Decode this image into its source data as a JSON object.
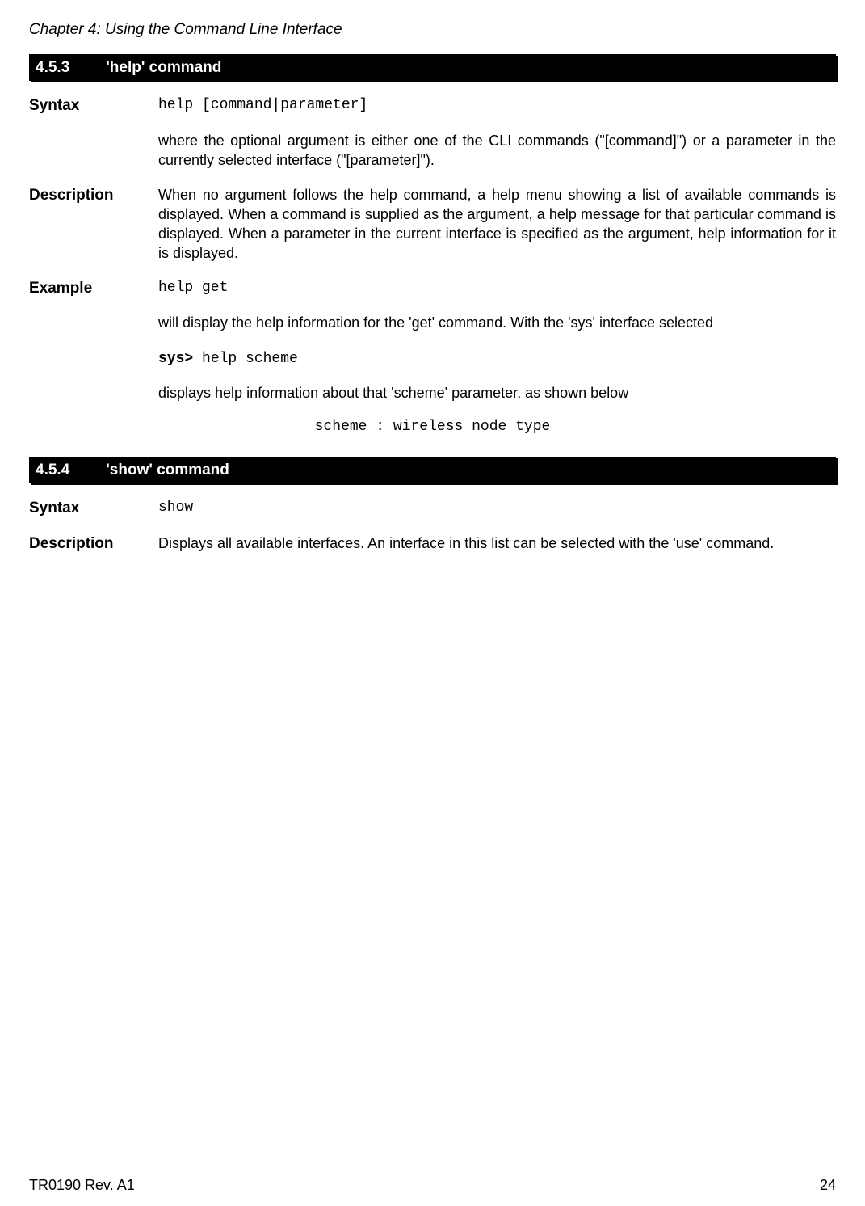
{
  "header": {
    "chapter": "Chapter 4: Using the Command Line Interface"
  },
  "section1": {
    "number": "4.5.3",
    "title": "'help' command",
    "syntax_label": "Syntax",
    "syntax_code": "help [command|parameter]",
    "syntax_text": "where the optional argument is either one of the CLI commands (\"[command]\") or a parameter in the currently selected interface (\"[parameter]\").",
    "description_label": "Description",
    "description_text": "When no argument follows the help command, a help menu showing a list of available commands is displayed. When a command is supplied as the argument, a help message for that particular command is displayed. When a parameter in the current interface is specified as the argument, help information for it is displayed.",
    "example_label": "Example",
    "example_code1": "help get",
    "example_text1": "will display the help information for the 'get' command. With the 'sys' interface selected",
    "example_prompt": "sys>",
    "example_prompt_cmd": " help scheme",
    "example_text2": "displays help information about that 'scheme' parameter, as shown below",
    "example_output": "scheme : wireless node type"
  },
  "section2": {
    "number": "4.5.4",
    "title": "'show' command",
    "syntax_label": "Syntax",
    "syntax_code": "show",
    "description_label": "Description",
    "description_text": "Displays all available interfaces. An interface in this list can be selected with the 'use' command."
  },
  "footer": {
    "doc_id": "TR0190 Rev. A1",
    "page": "24"
  }
}
